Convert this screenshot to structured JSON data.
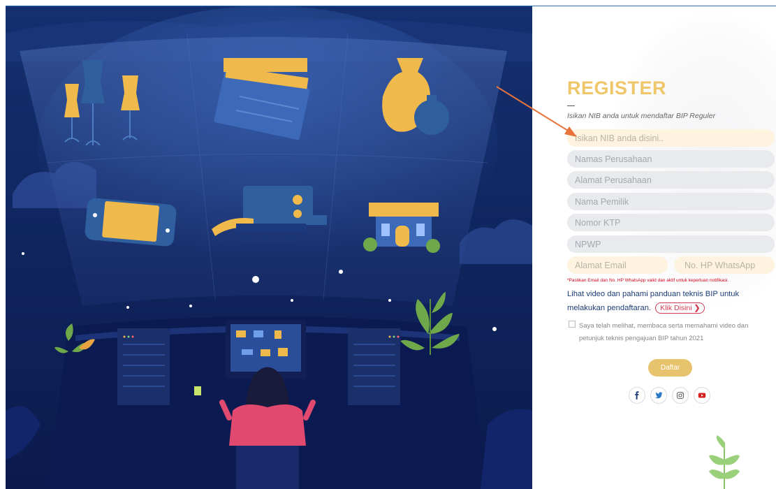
{
  "register": {
    "title": "REGISTER",
    "subtitle": "Isikan NIB anda untuk mendaftar BIP Reguler"
  },
  "form": {
    "nib_placeholder": "Isikan NIB anda disini..",
    "company_name_placeholder": "Namas Perusahaan",
    "company_address_placeholder": "Alamat Perusahaan",
    "owner_name_placeholder": "Nama Pemilik",
    "ktp_placeholder": "Nomor KTP",
    "npwp_placeholder": "NPWP",
    "email_placeholder": "Alamat Email",
    "whatsapp_placeholder": "No. HP WhatsApp",
    "validation_note": "*Pastikan Email dan No. HP WhatsApp valid dan aktif untuk keperluan notifikasi.",
    "help_text": "Lihat video dan pahami panduan teknis BIP untuk melakukan pendaftaran.",
    "klik_label": "Klik Disini",
    "agree_text": "Saya telah melihat, membaca serta memahami video dan petunjuk teknis pengajuan BIP tahun 2021",
    "submit_label": "Daftar"
  },
  "social": [
    "facebook-icon",
    "twitter-icon",
    "instagram-icon",
    "youtube-icon"
  ],
  "colors": {
    "accent_gold": "#efc76a",
    "button_gold": "#e8c36d",
    "navy": "#1d3d77",
    "red": "#d43b53",
    "arrow": "#e8743b",
    "illustration_bg": "#0d1f5a"
  }
}
